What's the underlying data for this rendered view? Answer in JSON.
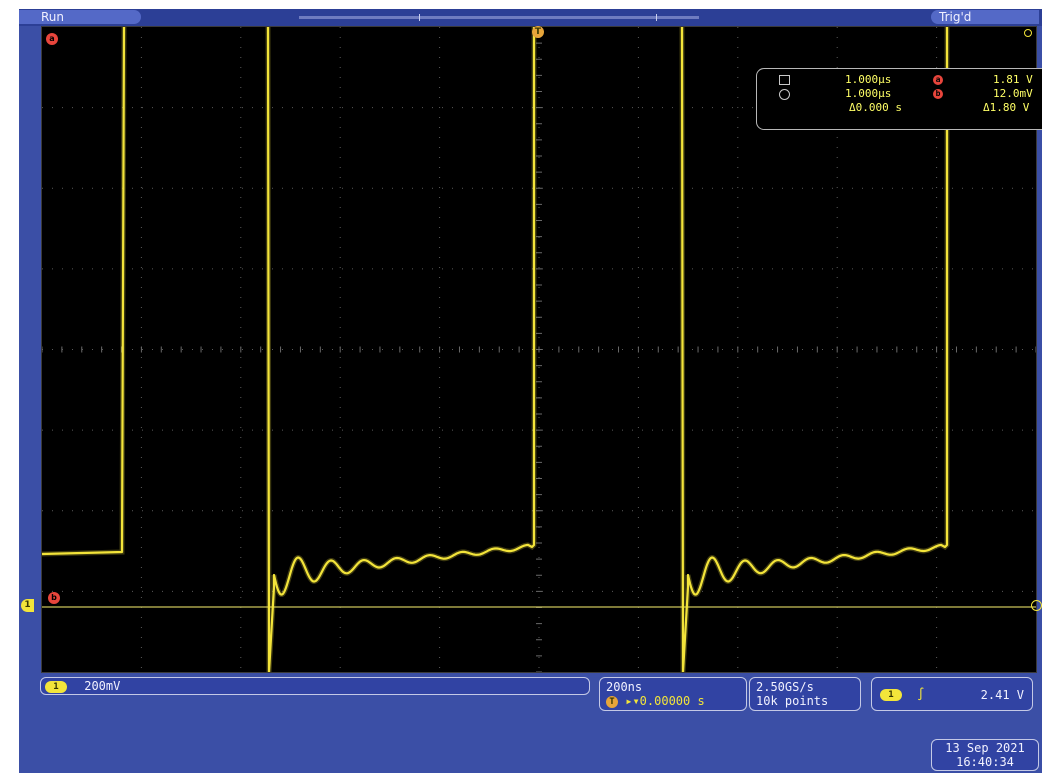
{
  "top_bar": {
    "run_status": "Run",
    "trigger_status": "Trig'd"
  },
  "screen": {
    "ch1_marker_label": "1",
    "ch1_trace_color": "#f3e53a",
    "trigger_point_marker": "T",
    "cursor_marker_a": "a",
    "cursor_marker_b": "b"
  },
  "cursor_readout": {
    "row1_time": "1.000µs",
    "row1_channel": "a",
    "row1_value": "1.81 V",
    "row2_time": "1.000µs",
    "row2_channel": "b",
    "row2_value": "12.0mV",
    "delta_time": "Δ0.000 s",
    "delta_value": "Δ1.80 V"
  },
  "bottom": {
    "channel_badge": "1",
    "channel_scale": "200mV",
    "timebase": "200ns",
    "trigger_pos_icon": "T",
    "horizontal_delay": "▸▾0.00000 s",
    "sample_rate": "2.50GS/s",
    "record_length": "10k points",
    "trigger_source_badge": "1",
    "trigger_slope_icon": "rising-edge-icon",
    "trigger_slope_glyph": "∫",
    "trigger_level": "2.41 V",
    "date": "13 Sep  2021",
    "time": "16:40:34"
  }
}
